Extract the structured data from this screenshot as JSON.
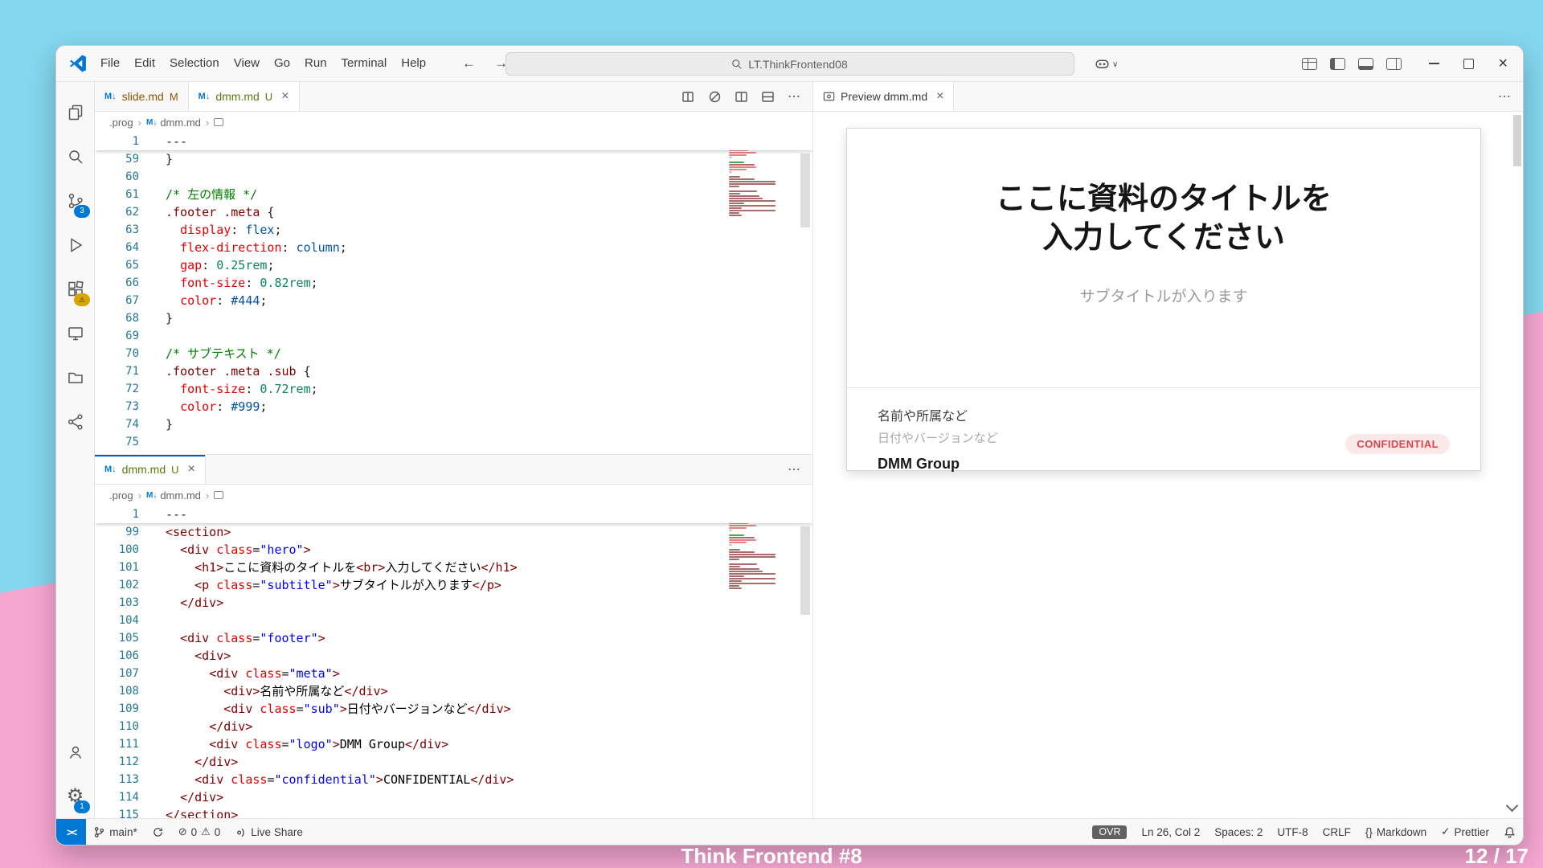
{
  "icons": {
    "markdown": "M↓",
    "close": "×",
    "more": "⋯",
    "back": "←",
    "forward": "→",
    "chevron_down": "∨",
    "crumb_sep": "›",
    "error": "⊘",
    "warning": "⚠",
    "check": "✓",
    "braces": "{}",
    "remote": "><"
  },
  "title_bar": {
    "menus": [
      "File",
      "Edit",
      "Selection",
      "View",
      "Go",
      "Run",
      "Terminal",
      "Help"
    ],
    "search_value": "LT.ThinkFrontend08"
  },
  "activity_bar": {
    "scm_badge": "3",
    "settings_badge": "1"
  },
  "groups": {
    "top": {
      "tabs": [
        {
          "label": "slide.md",
          "status": "M",
          "active": false
        },
        {
          "label": "dmm.md",
          "status": "U",
          "active": true
        }
      ],
      "breadcrumb": [
        ".prog",
        "dmm.md"
      ],
      "sticky_num": "1",
      "sticky_text": "---",
      "lines": [
        {
          "n": "59",
          "toks": [
            [
              "p",
              "}"
            ]
          ]
        },
        {
          "n": "60",
          "toks": []
        },
        {
          "n": "61",
          "toks": [
            [
              "c",
              "/* 左の情報 */"
            ]
          ]
        },
        {
          "n": "62",
          "toks": [
            [
              "s",
              ".footer .meta"
            ],
            [
              "p",
              " {"
            ]
          ]
        },
        {
          "n": "63",
          "toks": [
            [
              "p",
              "  "
            ],
            [
              "pr",
              "display"
            ],
            [
              "p",
              ": "
            ],
            [
              "kw",
              "flex"
            ],
            [
              "p",
              ";"
            ]
          ]
        },
        {
          "n": "64",
          "toks": [
            [
              "p",
              "  "
            ],
            [
              "pr",
              "flex-direction"
            ],
            [
              "p",
              ": "
            ],
            [
              "kw",
              "column"
            ],
            [
              "p",
              ";"
            ]
          ]
        },
        {
          "n": "65",
          "toks": [
            [
              "p",
              "  "
            ],
            [
              "pr",
              "gap"
            ],
            [
              "p",
              ": "
            ],
            [
              "n",
              "0.25rem"
            ],
            [
              "p",
              ";"
            ]
          ]
        },
        {
          "n": "66",
          "toks": [
            [
              "p",
              "  "
            ],
            [
              "pr",
              "font-size"
            ],
            [
              "p",
              ": "
            ],
            [
              "n",
              "0.82rem"
            ],
            [
              "p",
              ";"
            ]
          ]
        },
        {
          "n": "67",
          "toks": [
            [
              "p",
              "  "
            ],
            [
              "pr",
              "color"
            ],
            [
              "p",
              ": "
            ],
            [
              "hx",
              "#444"
            ],
            [
              "p",
              ";"
            ]
          ]
        },
        {
          "n": "68",
          "toks": [
            [
              "p",
              "}"
            ]
          ]
        },
        {
          "n": "69",
          "toks": []
        },
        {
          "n": "70",
          "toks": [
            [
              "c",
              "/* サブテキスト */"
            ]
          ]
        },
        {
          "n": "71",
          "toks": [
            [
              "s",
              ".footer .meta .sub"
            ],
            [
              "p",
              " {"
            ]
          ]
        },
        {
          "n": "72",
          "toks": [
            [
              "p",
              "  "
            ],
            [
              "pr",
              "font-size"
            ],
            [
              "p",
              ": "
            ],
            [
              "n",
              "0.72rem"
            ],
            [
              "p",
              ";"
            ]
          ]
        },
        {
          "n": "73",
          "toks": [
            [
              "p",
              "  "
            ],
            [
              "pr",
              "color"
            ],
            [
              "p",
              ": "
            ],
            [
              "hx",
              "#999"
            ],
            [
              "p",
              ";"
            ]
          ]
        },
        {
          "n": "74",
          "toks": [
            [
              "p",
              "}"
            ]
          ]
        },
        {
          "n": "75",
          "toks": []
        }
      ]
    },
    "bottom": {
      "tabs": [
        {
          "label": "dmm.md",
          "status": "U",
          "active": true,
          "accent": true
        }
      ],
      "breadcrumb": [
        ".prog",
        "dmm.md"
      ],
      "sticky_num": "1",
      "sticky_text": "---",
      "lines": [
        {
          "n": "99",
          "toks": [
            [
              "t",
              "<section>"
            ]
          ]
        },
        {
          "n": "100",
          "toks": [
            [
              "p",
              "  "
            ],
            [
              "t",
              "<div"
            ],
            [
              "p",
              " "
            ],
            [
              "a",
              "class"
            ],
            [
              "p",
              "="
            ],
            [
              "st",
              "\"hero\""
            ],
            [
              "t",
              ">"
            ]
          ]
        },
        {
          "n": "101",
          "toks": [
            [
              "p",
              "    "
            ],
            [
              "t",
              "<h1>"
            ],
            [
              "x",
              "ここに資料のタイトルを"
            ],
            [
              "t",
              "<br>"
            ],
            [
              "x",
              "入力してください"
            ],
            [
              "t",
              "</h1>"
            ]
          ]
        },
        {
          "n": "102",
          "toks": [
            [
              "p",
              "    "
            ],
            [
              "t",
              "<p"
            ],
            [
              "p",
              " "
            ],
            [
              "a",
              "class"
            ],
            [
              "p",
              "="
            ],
            [
              "st",
              "\"subtitle\""
            ],
            [
              "t",
              ">"
            ],
            [
              "x",
              "サブタイトルが入ります"
            ],
            [
              "t",
              "</p>"
            ]
          ]
        },
        {
          "n": "103",
          "toks": [
            [
              "p",
              "  "
            ],
            [
              "t",
              "</div>"
            ]
          ]
        },
        {
          "n": "104",
          "toks": []
        },
        {
          "n": "105",
          "toks": [
            [
              "p",
              "  "
            ],
            [
              "t",
              "<div"
            ],
            [
              "p",
              " "
            ],
            [
              "a",
              "class"
            ],
            [
              "p",
              "="
            ],
            [
              "st",
              "\"footer\""
            ],
            [
              "t",
              ">"
            ]
          ]
        },
        {
          "n": "106",
          "toks": [
            [
              "p",
              "    "
            ],
            [
              "t",
              "<div>"
            ]
          ]
        },
        {
          "n": "107",
          "toks": [
            [
              "p",
              "      "
            ],
            [
              "t",
              "<div"
            ],
            [
              "p",
              " "
            ],
            [
              "a",
              "class"
            ],
            [
              "p",
              "="
            ],
            [
              "st",
              "\"meta\""
            ],
            [
              "t",
              ">"
            ]
          ]
        },
        {
          "n": "108",
          "toks": [
            [
              "p",
              "        "
            ],
            [
              "t",
              "<div>"
            ],
            [
              "x",
              "名前や所属など"
            ],
            [
              "t",
              "</div>"
            ]
          ]
        },
        {
          "n": "109",
          "toks": [
            [
              "p",
              "        "
            ],
            [
              "t",
              "<div"
            ],
            [
              "p",
              " "
            ],
            [
              "a",
              "class"
            ],
            [
              "p",
              "="
            ],
            [
              "st",
              "\"sub\""
            ],
            [
              "t",
              ">"
            ],
            [
              "x",
              "日付やバージョンなど"
            ],
            [
              "t",
              "</div>"
            ]
          ]
        },
        {
          "n": "110",
          "toks": [
            [
              "p",
              "      "
            ],
            [
              "t",
              "</div>"
            ]
          ]
        },
        {
          "n": "111",
          "toks": [
            [
              "p",
              "      "
            ],
            [
              "t",
              "<div"
            ],
            [
              "p",
              " "
            ],
            [
              "a",
              "class"
            ],
            [
              "p",
              "="
            ],
            [
              "st",
              "\"logo\""
            ],
            [
              "t",
              ">"
            ],
            [
              "x",
              "DMM Group"
            ],
            [
              "t",
              "</div>"
            ]
          ]
        },
        {
          "n": "112",
          "toks": [
            [
              "p",
              "    "
            ],
            [
              "t",
              "</div>"
            ]
          ]
        },
        {
          "n": "113",
          "toks": [
            [
              "p",
              "    "
            ],
            [
              "t",
              "<div"
            ],
            [
              "p",
              " "
            ],
            [
              "a",
              "class"
            ],
            [
              "p",
              "="
            ],
            [
              "st",
              "\"confidential\""
            ],
            [
              "t",
              ">"
            ],
            [
              "x",
              "CONFIDENTIAL"
            ],
            [
              "t",
              "</div>"
            ]
          ]
        },
        {
          "n": "114",
          "toks": [
            [
              "p",
              "  "
            ],
            [
              "t",
              "</div>"
            ]
          ]
        },
        {
          "n": "115",
          "toks": [
            [
              "t",
              "</section>"
            ]
          ]
        }
      ]
    }
  },
  "preview": {
    "tab_label": "Preview dmm.md",
    "slide": {
      "title_line1": "ここに資料のタイトルを",
      "title_line2": "入力してください",
      "subtitle": "サブタイトルが入ります",
      "meta_name": "名前や所属など",
      "meta_sub": "日付やバージョンなど",
      "logo": "DMM Group",
      "confidential": "CONFIDENTIAL"
    }
  },
  "status_bar": {
    "branch": "main*",
    "errors": "0",
    "warnings": "0",
    "live_share": "Live Share",
    "ovr": "OVR",
    "cursor": "Ln 26, Col 2",
    "spaces": "Spaces: 2",
    "encoding": "UTF-8",
    "eol": "CRLF",
    "language": "Markdown",
    "prettier": "Prettier"
  },
  "overlay": {
    "deck_title": "Think Frontend #8",
    "page_indicator": "12 / 17"
  }
}
